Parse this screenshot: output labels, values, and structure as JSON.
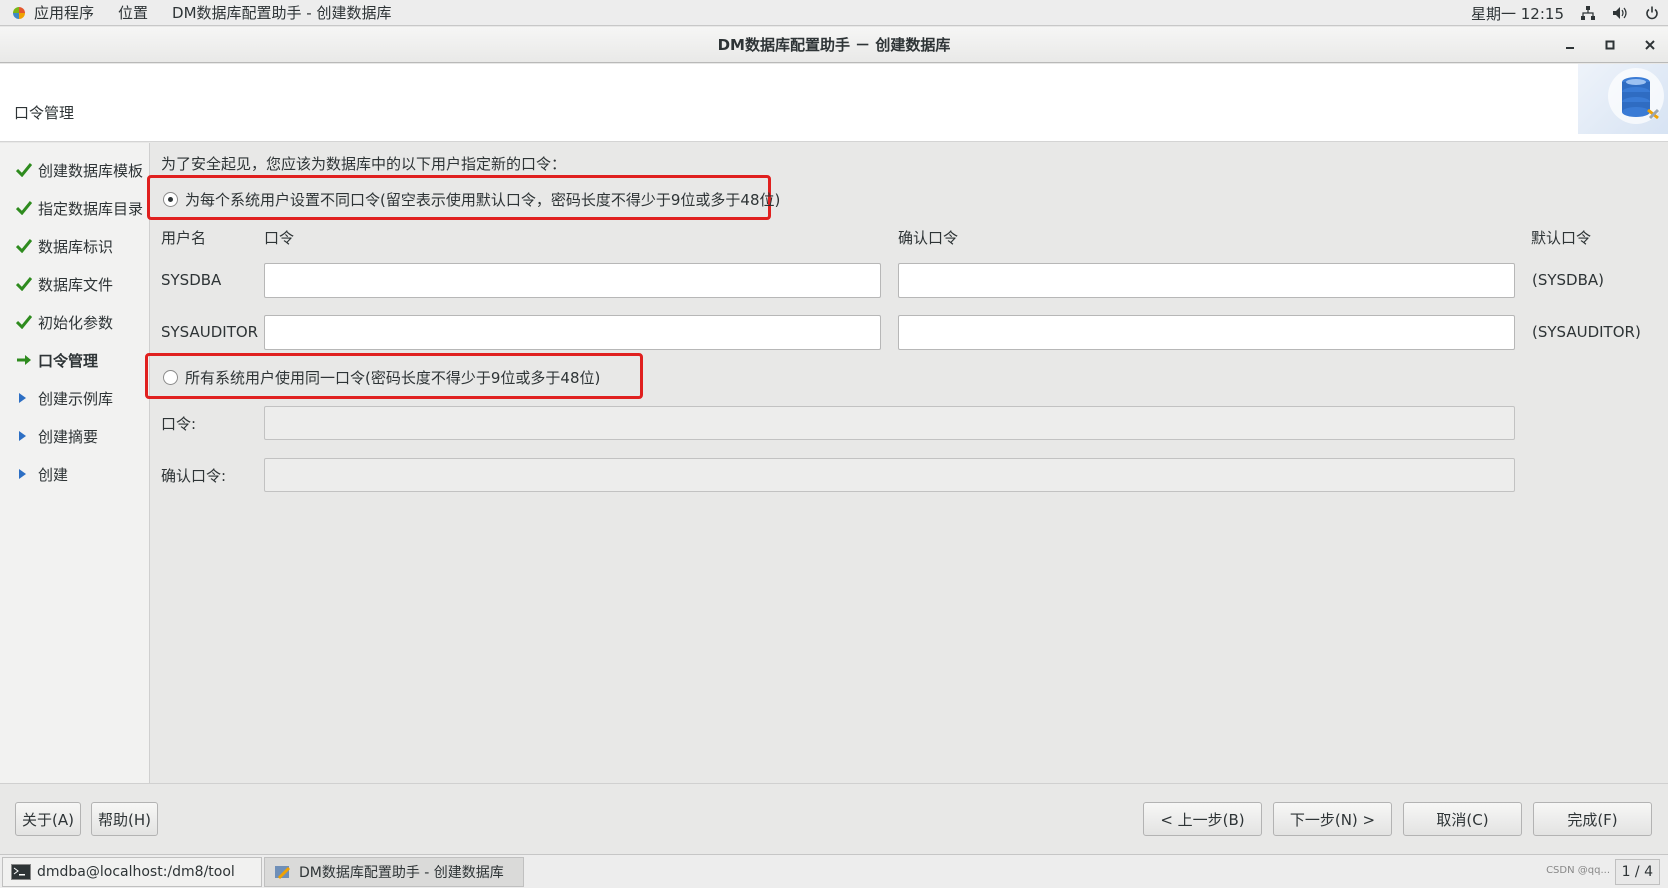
{
  "top_panel": {
    "menus": [
      "应用程序",
      "位置",
      "DM数据库配置助手 - 创建数据库"
    ],
    "clock": "星期一 12:15",
    "icons": [
      "network-icon",
      "volume-icon",
      "power-icon"
    ]
  },
  "window": {
    "title": "DM数据库配置助手 － 创建数据库",
    "controls": [
      "minimize-icon",
      "maximize-icon",
      "close-icon"
    ]
  },
  "header": {
    "title": "口令管理"
  },
  "sidebar": {
    "steps": [
      {
        "label": "创建数据库模板",
        "state": "done"
      },
      {
        "label": "指定数据库目录",
        "state": "done"
      },
      {
        "label": "数据库标识",
        "state": "done"
      },
      {
        "label": "数据库文件",
        "state": "done"
      },
      {
        "label": "初始化参数",
        "state": "done"
      },
      {
        "label": "口令管理",
        "state": "current"
      },
      {
        "label": "创建示例库",
        "state": "pending"
      },
      {
        "label": "创建摘要",
        "state": "pending"
      },
      {
        "label": "创建",
        "state": "pending"
      }
    ]
  },
  "main": {
    "intro": "为了安全起见，您应该为数据库中的以下用户指定新的口令：",
    "option_individual": {
      "label": "为每个系统用户设置不同口令(留空表示使用默认口令，密码长度不得少于9位或多于48位)",
      "selected": true
    },
    "columns": {
      "username": "用户名",
      "password": "口令",
      "confirm": "确认口令",
      "default": "默认口令"
    },
    "users": [
      {
        "name": "SYSDBA",
        "password": "",
        "confirm": "",
        "default": "(SYSDBA)"
      },
      {
        "name": "SYSAUDITOR",
        "password": "",
        "confirm": "",
        "default": "(SYSAUDITOR)"
      }
    ],
    "option_same": {
      "label": "所有系统用户使用同一口令(密码长度不得少于9位或多于48位)",
      "selected": false
    },
    "same_password_label": "口令:",
    "same_confirm_label": "确认口令:"
  },
  "buttons": {
    "about": "关于(A)",
    "help": "帮助(H)",
    "back": "< 上一步(B)",
    "next": "下一步(N) >",
    "cancel": "取消(C)",
    "finish": "完成(F)"
  },
  "taskbar": {
    "tasks": [
      "dmdba@localhost:/dm8/tool",
      "DM数据库配置助手 - 创建数据库"
    ],
    "pager": "1 / 4",
    "watermark": "CSDN @qq..."
  },
  "colors": {
    "highlight": "#e0201f",
    "check": "#2e8b1e",
    "arrow_current": "#2e8b1e",
    "arrow_pending": "#2d6fc4"
  }
}
